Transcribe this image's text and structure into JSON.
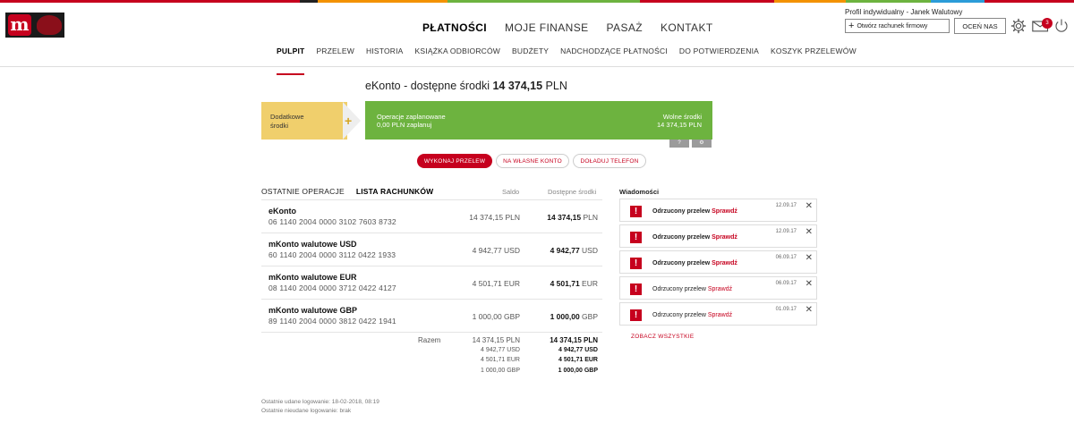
{
  "colors": {
    "accent": "#c6001e",
    "green": "#6db33f",
    "yellow": "#f0cf6c",
    "stripe": [
      "#c6001e",
      "#c6001e",
      "#f39200",
      "#6db33f",
      "#2b9cd8",
      "#c6001e",
      "#f39200",
      "#6db33f",
      "#2b9cd8",
      "#c6001e"
    ]
  },
  "header": {
    "logo_icon": "mbank-logo-icon",
    "main_nav": [
      {
        "label": "PŁATNOŚCI",
        "active": true
      },
      {
        "label": "MOJE FINANSE",
        "active": false
      },
      {
        "label": "PASAŻ",
        "active": false
      },
      {
        "label": "KONTAKT",
        "active": false
      }
    ],
    "profile": "Profil indywidualny  -  Janek Walutowy",
    "open_account": "Otwórz rachunek firmowy",
    "rate": "OCEŃ NAS",
    "mail_badge": "3",
    "icons": [
      "gear-icon",
      "mail-icon",
      "power-icon"
    ]
  },
  "subnav": [
    {
      "label": "PULPIT",
      "active": true
    },
    {
      "label": "PRZELEW",
      "active": false
    },
    {
      "label": "HISTORIA",
      "active": false
    },
    {
      "label": "KSIĄŻKA ODBIORCÓW",
      "active": false
    },
    {
      "label": "BUDŻETY",
      "active": false
    },
    {
      "label": "NADCHODZĄCE PŁATNOŚCI",
      "active": false
    },
    {
      "label": "DO POTWIERDZENIA",
      "active": false
    },
    {
      "label": "KOSZYK PRZELEWÓW",
      "active": false
    }
  ],
  "account_header": {
    "prefix": "eKonto - dostępne środki ",
    "amount": "14 374,15",
    "currency": " PLN"
  },
  "extra_funds": {
    "line1": "Dodatkowe",
    "line2": "środki"
  },
  "planned": {
    "label": "Operacje zaplanowane",
    "value": "0,00 PLN zaplanuj",
    "free_label": "Wolne środki",
    "free_value": "14 374,15 PLN",
    "btn_help": "?",
    "btn_settings": "⚙"
  },
  "actions": {
    "transfer": "WYKONAJ PRZELEW",
    "own": "NA WŁASNE KONTO",
    "topup": "DOŁADUJ TELEFON"
  },
  "tabs": {
    "recent": "OSTATNIE OPERACJE",
    "accounts": "LISTA RACHUNKÓW"
  },
  "columns": {
    "saldo": "Saldo",
    "available": "Dostępne środki"
  },
  "accounts": [
    {
      "name": "eKonto",
      "number": "06 1140 2004 0000 3102 7603 8732",
      "balance": "14 374,15 PLN",
      "available": "14 374,15",
      "currency": "PLN"
    },
    {
      "name": "mKonto walutowe USD",
      "number": "60 1140 2004 0000 3112 0422 1933",
      "balance": "4 942,77 USD",
      "available": "4 942,77",
      "currency": "USD"
    },
    {
      "name": "mKonto walutowe EUR",
      "number": "08 1140 2004 0000 3712 0422 4127",
      "balance": "4 501,71 EUR",
      "available": "4 501,71",
      "currency": "EUR"
    },
    {
      "name": "mKonto walutowe GBP",
      "number": "89 1140 2004 0000 3812 0422 1941",
      "balance": "1 000,00 GBP",
      "available": "1 000,00",
      "currency": "GBP"
    }
  ],
  "summary": {
    "label": "Razem",
    "rows": [
      {
        "balance": "14 374,15 PLN",
        "available": "14 374,15 PLN"
      },
      {
        "balance": "4 942,77 USD",
        "available": "4 942,77 USD"
      },
      {
        "balance": "4 501,71 EUR",
        "available": "4 501,71 EUR"
      },
      {
        "balance": "1 000,00 GBP",
        "available": "1 000,00 GBP"
      }
    ]
  },
  "messages": {
    "title": "Wiadomości",
    "items": [
      {
        "text": "Odrzucony przelew ",
        "link": "Sprawdź",
        "date": "12.09.17",
        "unread": true
      },
      {
        "text": "Odrzucony przelew ",
        "link": "Sprawdź",
        "date": "12.09.17",
        "unread": true
      },
      {
        "text": "Odrzucony przelew ",
        "link": "Sprawdź",
        "date": "06.09.17",
        "unread": true
      },
      {
        "text": "Odrzucony przelew ",
        "link": "Sprawdź",
        "date": "06.09.17",
        "unread": false
      },
      {
        "text": "Odrzucony przelew ",
        "link": "Sprawdź",
        "date": "01.09.17",
        "unread": false
      }
    ],
    "see_all": "ZOBACZ WSZYSTKIE"
  },
  "login": {
    "last_success": "Ostatnie udane logowanie: 18-02-2018, 08:19",
    "last_fail": "Ostatnie nieudane logowanie: brak"
  }
}
